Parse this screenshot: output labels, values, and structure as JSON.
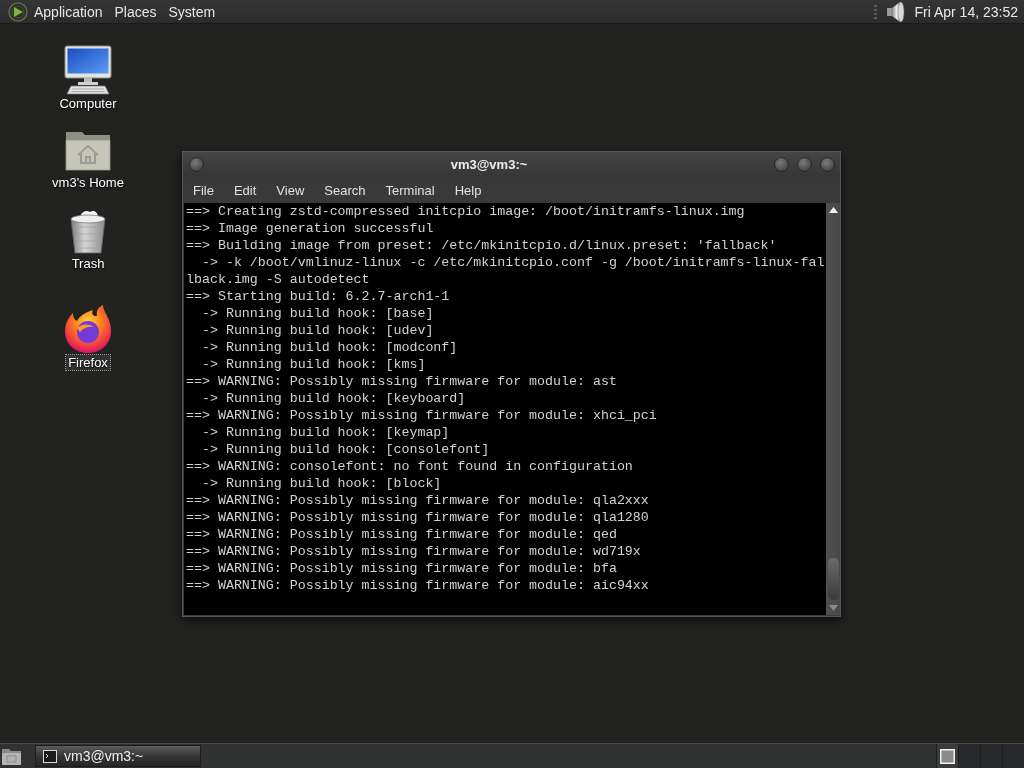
{
  "top_panel": {
    "menus": [
      "Application",
      "Places",
      "System"
    ],
    "clock": "Fri Apr 14, 23:52"
  },
  "desktop_icons": [
    {
      "kind": "computer",
      "label": "Computer",
      "selected": false
    },
    {
      "kind": "home",
      "label": "vm3's Home",
      "selected": false
    },
    {
      "kind": "trash",
      "label": "Trash",
      "selected": false
    },
    {
      "kind": "firefox",
      "label": "Firefox",
      "selected": true
    }
  ],
  "window": {
    "title": "vm3@vm3:~",
    "menu": [
      "File",
      "Edit",
      "View",
      "Search",
      "Terminal",
      "Help"
    ],
    "lines": [
      "==> Creating zstd-compressed initcpio image: /boot/initramfs-linux.img",
      "==> Image generation successful",
      "==> Building image from preset: /etc/mkinitcpio.d/linux.preset: 'fallback'",
      "  -> -k /boot/vmlinuz-linux -c /etc/mkinitcpio.conf -g /boot/initramfs-linux-fal",
      "lback.img -S autodetect",
      "==> Starting build: 6.2.7-arch1-1",
      "  -> Running build hook: [base]",
      "  -> Running build hook: [udev]",
      "  -> Running build hook: [modconf]",
      "  -> Running build hook: [kms]",
      "==> WARNING: Possibly missing firmware for module: ast",
      "  -> Running build hook: [keyboard]",
      "==> WARNING: Possibly missing firmware for module: xhci_pci",
      "  -> Running build hook: [keymap]",
      "  -> Running build hook: [consolefont]",
      "==> WARNING: consolefont: no font found in configuration",
      "  -> Running build hook: [block]",
      "==> WARNING: Possibly missing firmware for module: qla2xxx",
      "==> WARNING: Possibly missing firmware for module: qla1280",
      "==> WARNING: Possibly missing firmware for module: qed",
      "==> WARNING: Possibly missing firmware for module: wd719x",
      "==> WARNING: Possibly missing firmware for module: bfa",
      "==> WARNING: Possibly missing firmware for module: aic94xx"
    ]
  },
  "bottom_panel": {
    "tasks": [
      {
        "label": "vm3@vm3:~",
        "selected": true
      }
    ],
    "workspaces": [
      {
        "selected": true
      },
      {
        "selected": false
      },
      {
        "selected": false
      },
      {
        "selected": false
      }
    ]
  }
}
